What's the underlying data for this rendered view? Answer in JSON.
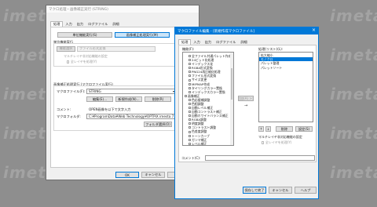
{
  "background": {
    "watermark": "imeta"
  },
  "back_window": {
    "title": "マクロ処理・画像補正実行 (STRING)",
    "tabs": [
      "処理",
      "入力",
      "出力",
      "ログファイル",
      "詳細"
    ],
    "mode_buttons": [
      "単位機能実行(S)",
      "画像補正処理実行(M)"
    ],
    "single_section_label": "単位機能実行",
    "func_select_button": "機能選択",
    "func_field_placeholder": "ファイル形式変換",
    "settings_button": "設定(S)...",
    "multilayer_check": "マルチレイヤ非対応機能の設定",
    "all_layers_check": "全レイヤを処理(Y)",
    "macro_section_label": "画像補正処理実行 (マクロファイル実行)",
    "macro_file_label": "マクロファイル(F):",
    "macro_file_value": "STRING",
    "edit_button": "編集(E)...",
    "new_button": "新規作成(N)...",
    "delete_button": "削除(R)",
    "comment_label": "コメント:",
    "comment_value": "OPEN画像を以下で文字入力",
    "macro_folder_label": "マクロフォルダ:",
    "macro_folder_value": "C:¥ProgramData¥Web Technology¥OPTPiX imesta 7 for",
    "folder_select_button": "フォルダ選択(O)",
    "change_button": "変更",
    "ok_button": "OK",
    "cancel_button": "キャンセル",
    "help_button": "ヘルプ"
  },
  "front_window": {
    "title": "マクロファイル編集 - [新規作成マクロファイル]",
    "close_icon": "×",
    "tabs": [
      "処理",
      "入力",
      "出力",
      "ログファイル",
      "詳細"
    ],
    "func_list_label": "機能(F):",
    "tree_items": [
      {
        "label": "全ファイル共通パレット作成",
        "indent": 1,
        "box": true
      },
      {
        "label": "24ビット化処理",
        "indent": 1,
        "box": true
      },
      {
        "label": "インデックス化",
        "indent": 1,
        "box": true
      },
      {
        "label": "RGBA形式変換",
        "indent": 1,
        "box": true
      },
      {
        "label": "PNG24再圧縮化処理",
        "indent": 1,
        "box": true
      },
      {
        "label": "ファイル形式変換",
        "indent": 1,
        "box": true
      },
      {
        "label": "サイズ変更",
        "indent": 1,
        "box": true
      },
      {
        "label": "MIPMAP作成",
        "indent": 1,
        "box": true
      },
      {
        "label": "タイリングカラー置換",
        "indent": 1,
        "box": true
      },
      {
        "label": "インデックスカラー置換",
        "indent": 1,
        "box": true
      },
      {
        "label": "画像補正",
        "indent": 0,
        "box": true
      },
      {
        "label": "色応援補調整",
        "indent": 1,
        "box": true
      },
      {
        "label": "色相調整",
        "indent": 1,
        "box": true
      },
      {
        "label": "自動レベル補正",
        "indent": 1,
        "box": true
      },
      {
        "label": "自動コントラスト補正",
        "indent": 1,
        "box": true
      },
      {
        "label": "自動ホワイトバランス補正",
        "indent": 1,
        "box": true
      },
      {
        "label": "RGBA調整",
        "indent": 1,
        "box": true
      },
      {
        "label": "明度調整",
        "indent": 1,
        "box": true
      },
      {
        "label": "コントラスト調整",
        "indent": 1,
        "box": true
      },
      {
        "label": "色差度調整",
        "indent": 1,
        "box": true
      },
      {
        "label": "トーンカーブ",
        "indent": 1,
        "box": true
      },
      {
        "label": "ガンマ補正",
        "indent": 1,
        "box": true
      },
      {
        "label": "レベル補正",
        "indent": 1,
        "box": true
      }
    ],
    "add_button": "追加(A) >>",
    "arrow": "→",
    "order_label": "処理(リスト)(L):",
    "order_items": [
      "拡大縮小",
      "モノクロ",
      "パレット整理",
      "パレットソート"
    ],
    "order_selected": 1,
    "up_button": "↑",
    "down_button": "↓",
    "delete_button": "削除",
    "settings_button": "設定(S)",
    "multilayer_check": "マルチレイヤ非対応機能の設定",
    "all_layers_check": "全レイヤを処理(Y)",
    "comment_label": "コメント(C):",
    "comment_value": "",
    "save_button": "保存して終了",
    "cancel_button": "キャンセル",
    "help_button": "ヘルプ"
  }
}
